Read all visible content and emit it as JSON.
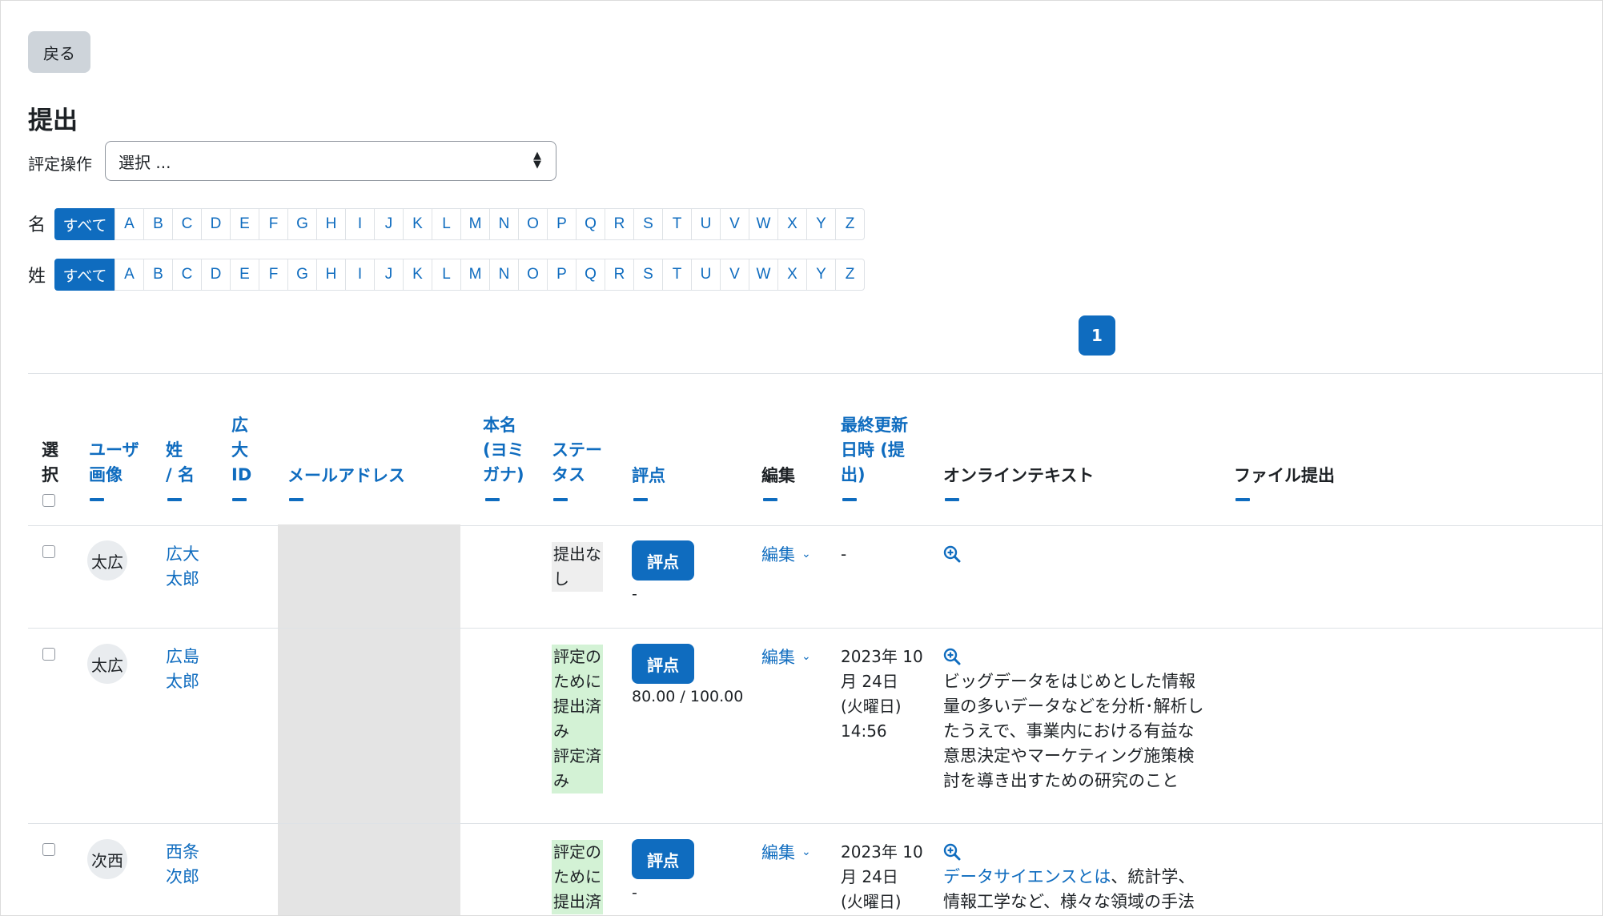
{
  "back_button": "戻る",
  "page_title": "提出",
  "grading_action": {
    "label": "評定操作",
    "select_value": "選択 ..."
  },
  "first_name_filter": {
    "label": "名",
    "all": "すべて",
    "letters": [
      "A",
      "B",
      "C",
      "D",
      "E",
      "F",
      "G",
      "H",
      "I",
      "J",
      "K",
      "L",
      "M",
      "N",
      "O",
      "P",
      "Q",
      "R",
      "S",
      "T",
      "U",
      "V",
      "W",
      "X",
      "Y",
      "Z"
    ]
  },
  "last_name_filter": {
    "label": "姓",
    "all": "すべて",
    "letters": [
      "A",
      "B",
      "C",
      "D",
      "E",
      "F",
      "G",
      "H",
      "I",
      "J",
      "K",
      "L",
      "M",
      "N",
      "O",
      "P",
      "Q",
      "R",
      "S",
      "T",
      "U",
      "V",
      "W",
      "X",
      "Y",
      "Z"
    ]
  },
  "pagination": {
    "current_page": "1"
  },
  "table": {
    "headers": {
      "select": [
        "選",
        "択"
      ],
      "user_picture": [
        "ユーザ",
        "画像"
      ],
      "name": [
        "姓",
        "/ 名"
      ],
      "id": [
        "広",
        "大",
        "ID"
      ],
      "email": "メールアドレス",
      "real_name": [
        "本名",
        "(ヨミ",
        "ガナ)"
      ],
      "status": [
        "ステー",
        "タス"
      ],
      "grade": "評点",
      "edit": "編集",
      "last_modified": [
        "最終更新",
        "日時 (提",
        "出)"
      ],
      "online_text": "オンラインテキスト",
      "file_submission": "ファイル提出"
    },
    "rows": [
      {
        "avatar": "太広",
        "name_lines": [
          "広大",
          "太郎"
        ],
        "status_lines": [
          "提出な",
          "し"
        ],
        "status_type": "none",
        "grade_button": "評点",
        "grade_value": "-",
        "edit": "編集",
        "last_modified": [
          "-"
        ],
        "online_text": []
      },
      {
        "avatar": "太広",
        "name_lines": [
          "広島",
          "太郎"
        ],
        "status_lines": [
          "評定の",
          "ために",
          "提出済",
          "み",
          "評定済",
          "み"
        ],
        "status_type": "submitted",
        "grade_button": "評点",
        "grade_value": "80.00 / 100.00",
        "edit": "編集",
        "last_modified": [
          "2023年 10",
          "月 24日",
          "(火曜日)",
          "14:56"
        ],
        "online_text": [
          "ビッグデータをはじめとした情報",
          "量の多いデータなどを分析･解析し",
          "たうえで、事業内における有益な",
          "意思決定やマーケティング施策検",
          "討を導き出すための研究のこと"
        ]
      },
      {
        "avatar": "次西",
        "name_lines": [
          "西条",
          "次郎"
        ],
        "status_lines": [
          "評定の",
          "ために",
          "提出済"
        ],
        "status_type": "submitted",
        "grade_button": "評点",
        "grade_value": "-",
        "edit": "編集",
        "last_modified": [
          "2023年 10",
          "月 24日",
          "(火曜日)"
        ],
        "online_text_link": "データサイエンスとは",
        "online_text_rest": "、統計学、",
        "online_text_line2": "情報工学など、様々な領域の手法"
      }
    ]
  }
}
